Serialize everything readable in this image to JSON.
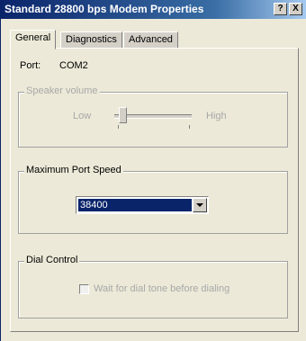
{
  "window": {
    "title": "Standard 28800 bps Modem Properties",
    "help_label": "?",
    "close_label": "X"
  },
  "tabs": [
    {
      "label": "General",
      "active": true
    },
    {
      "label": "Diagnostics",
      "active": false
    },
    {
      "label": "Advanced",
      "active": false
    }
  ],
  "general": {
    "port_label": "Port:",
    "port_value": "COM2",
    "speaker": {
      "legend": "Speaker volume",
      "low_label": "Low",
      "high_label": "High",
      "level": 0.1,
      "enabled": false
    },
    "port_speed": {
      "legend": "Maximum Port Speed",
      "selected": "38400"
    },
    "dial": {
      "legend": "Dial Control",
      "checkbox_label": "Wait for dial tone before dialing",
      "checked": false,
      "enabled": false
    }
  },
  "colors": {
    "titlebar_start": "#0a246a",
    "selection": "#0a246a",
    "face": "#d4d0c8",
    "disabled_text": "#a8a8a8"
  }
}
